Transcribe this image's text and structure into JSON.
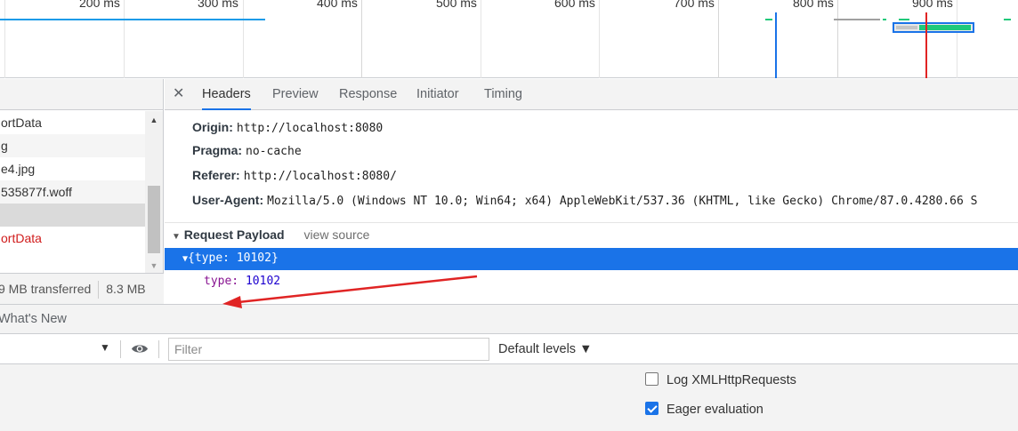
{
  "timeline": {
    "ticks": [
      "200 ms",
      "300 ms",
      "400 ms",
      "500 ms",
      "600 ms",
      "700 ms",
      "800 ms",
      "900 ms"
    ]
  },
  "request_list": {
    "rows": [
      "ortData",
      "g",
      "e4.jpg",
      "535877f.woff",
      "",
      "ortData",
      ""
    ],
    "status_transferred": "9 MB transferred",
    "status_resources": "8.3 MB"
  },
  "details": {
    "tabs": [
      "Headers",
      "Preview",
      "Response",
      "Initiator",
      "Timing"
    ],
    "active_tab": "Headers",
    "headers": [
      {
        "name": "Origin:",
        "value": "http://localhost:8080"
      },
      {
        "name": "Pragma:",
        "value": "no-cache"
      },
      {
        "name": "Referer:",
        "value": "http://localhost:8080/"
      },
      {
        "name": "User-Agent:",
        "value": "Mozilla/5.0 (Windows NT 10.0; Win64; x64) AppleWebKit/537.36 (KHTML, like Gecko) Chrome/87.0.4280.66 S"
      }
    ],
    "payload": {
      "title": "Request Payload",
      "view_source": "view source",
      "tree_summary": "{type: 10102}",
      "prop_key": "type:",
      "prop_value": "10102"
    }
  },
  "drawer": {
    "tab": "What's New"
  },
  "console": {
    "filter_placeholder": "Filter",
    "levels": "Default levels ▼",
    "log_xhr": "Log XMLHttpRequests",
    "eager_eval": "Eager evaluation",
    "log_xhr_checked": false,
    "eager_eval_checked": true
  },
  "colors": {
    "accent": "#1a73e8",
    "error_text": "#d01b1b",
    "annotation_arrow": "#e02424"
  }
}
